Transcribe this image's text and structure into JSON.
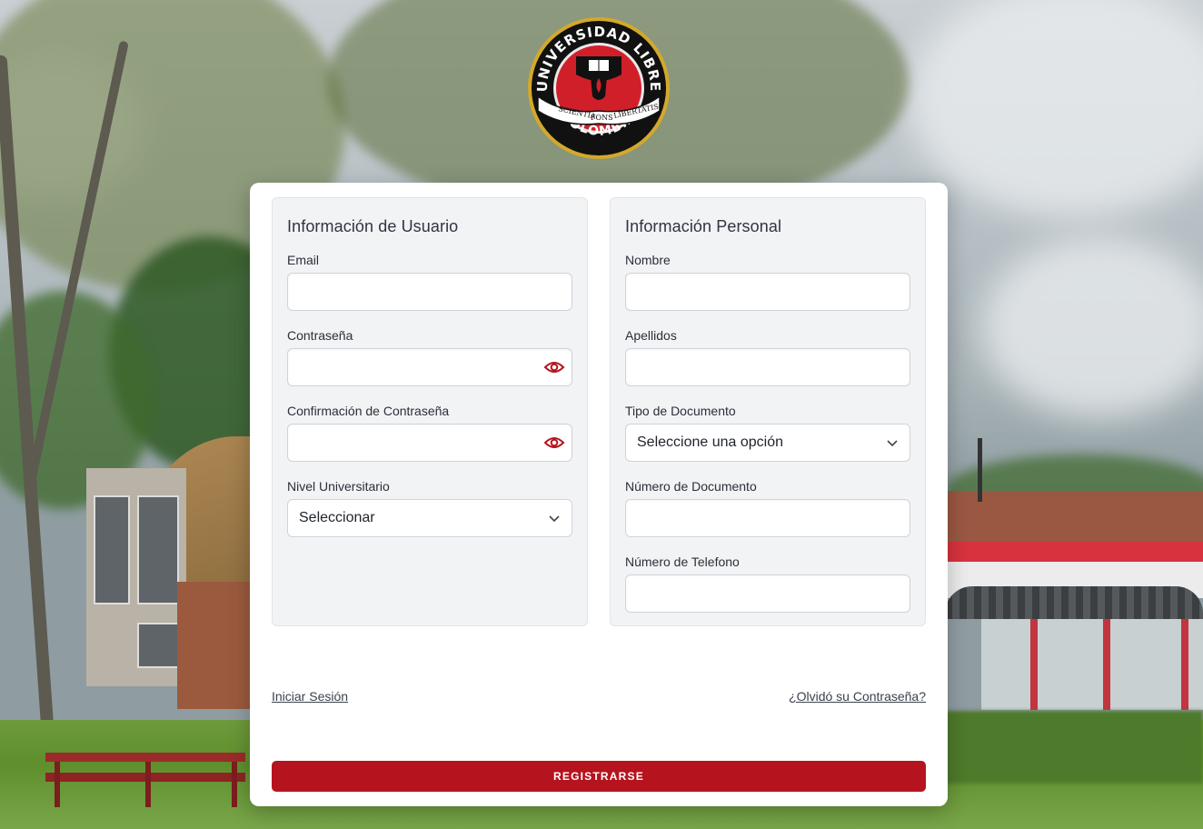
{
  "logo": {
    "top_text": "UNIVERSIDAD LIBRE",
    "bottom_text": "COLOMBIA",
    "ribbon_left": "SCIENTIA",
    "ribbon_center": "FONS",
    "ribbon_right": "LIBERTATIS"
  },
  "user_info": {
    "title": "Información de Usuario",
    "email_label": "Email",
    "email_value": "",
    "password_label": "Contraseña",
    "password_value": "",
    "confirm_password_label": "Confirmación de Contraseña",
    "confirm_password_value": "",
    "level_label": "Nivel Universitario",
    "level_value": "Seleccionar"
  },
  "personal_info": {
    "title": "Información Personal",
    "name_label": "Nombre",
    "name_value": "",
    "lastname_label": "Apellidos",
    "lastname_value": "",
    "doc_type_label": "Tipo de Documento",
    "doc_type_value": "Seleccione una opción",
    "doc_number_label": "Número de Documento",
    "doc_number_value": "",
    "phone_label": "Número de Telefono",
    "phone_value": ""
  },
  "links": {
    "login": "Iniciar Sesión",
    "forgot": "¿Olvidó su Contraseña?"
  },
  "submit_label": "REGISTRARSE",
  "colors": {
    "accent": "#b5141f",
    "panel_bg": "#f2f3f5",
    "card_bg": "#ffffff",
    "eye_icon": "#b5141f"
  }
}
